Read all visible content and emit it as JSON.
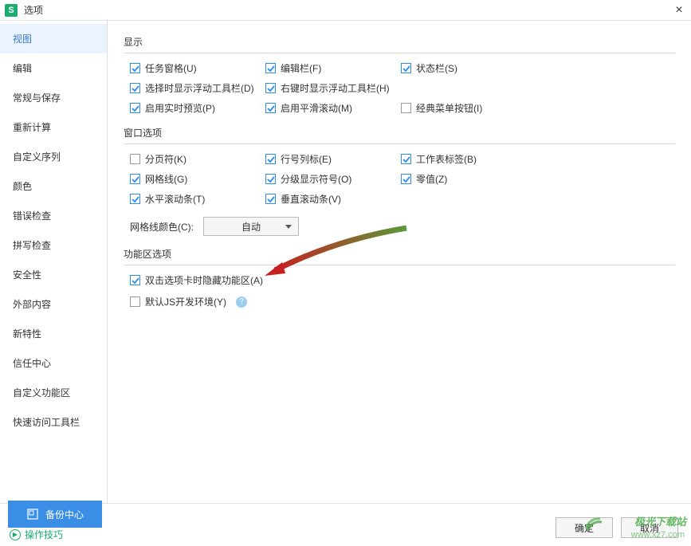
{
  "titlebar": {
    "app_icon_text": "S",
    "title": "选项",
    "close_icon": "×"
  },
  "sidebar": {
    "items": [
      {
        "label": "视图",
        "active": true
      },
      {
        "label": "编辑"
      },
      {
        "label": "常规与保存"
      },
      {
        "label": "重新计算"
      },
      {
        "label": "自定义序列"
      },
      {
        "label": "颜色"
      },
      {
        "label": "错误检查"
      },
      {
        "label": "拼写检查"
      },
      {
        "label": "安全性"
      },
      {
        "label": "外部内容"
      },
      {
        "label": "新特性"
      },
      {
        "label": "信任中心"
      },
      {
        "label": "自定义功能区"
      },
      {
        "label": "快速访问工具栏"
      }
    ]
  },
  "groups": {
    "display": {
      "title": "显示",
      "items": [
        {
          "label": "任务窗格(U)",
          "checked": true
        },
        {
          "label": "编辑栏(F)",
          "checked": true
        },
        {
          "label": "状态栏(S)",
          "checked": true
        },
        {
          "label": "选择时显示浮动工具栏(D)",
          "checked": true
        },
        {
          "label": "右键时显示浮动工具栏(H)",
          "checked": true
        },
        {
          "label": ""
        },
        {
          "label": "启用实时预览(P)",
          "checked": true
        },
        {
          "label": "启用平滑滚动(M)",
          "checked": true
        },
        {
          "label": "经典菜单按钮(I)",
          "checked": false
        }
      ]
    },
    "window": {
      "title": "窗口选项",
      "items": [
        {
          "label": "分页符(K)",
          "checked": false
        },
        {
          "label": "行号列标(E)",
          "checked": true
        },
        {
          "label": "工作表标签(B)",
          "checked": true
        },
        {
          "label": "网格线(G)",
          "checked": true
        },
        {
          "label": "分级显示符号(O)",
          "checked": true
        },
        {
          "label": "零值(Z)",
          "checked": true
        },
        {
          "label": "水平滚动条(T)",
          "checked": true
        },
        {
          "label": "垂直滚动条(V)",
          "checked": true
        }
      ],
      "color_label": "网格线颜色(C):",
      "color_value": "自动"
    },
    "function": {
      "title": "功能区选项",
      "items": [
        {
          "label": "双击选项卡时隐藏功能区(A)",
          "checked": true
        },
        {
          "label": "默认JS开发环境(Y)",
          "checked": false,
          "help": true
        }
      ]
    }
  },
  "bottom": {
    "backup_label": "备份中心",
    "tips_label": "操作技巧",
    "ok_label": "确定",
    "cancel_label": "取消"
  },
  "watermark": {
    "text": "极光下载站",
    "url": "www.xz7.com"
  }
}
